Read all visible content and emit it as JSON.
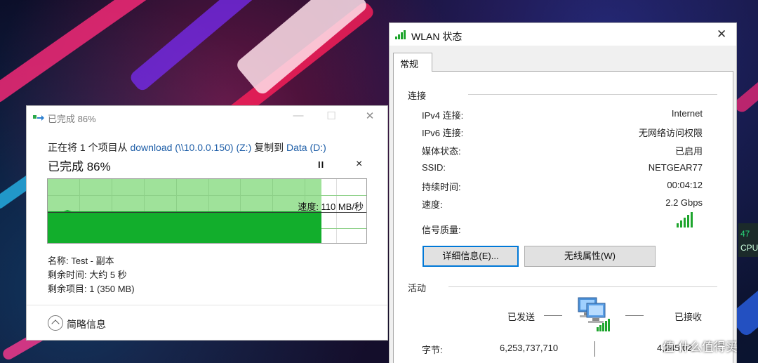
{
  "copy_dialog": {
    "title": "已完成 86%",
    "progress_percent": 86,
    "desc": {
      "prefix": "正在将 1 个项目从 ",
      "source": "download (\\\\10.0.0.150) (Z:)",
      "middle": " 复制到 ",
      "dest": "Data (D:)"
    },
    "heading": "已完成 86%",
    "pause_label": "II",
    "cancel_label": "×",
    "speed_label": "速度: 110 MB/秒",
    "name_line": "名称: Test - 副本",
    "time_line": "剩余时间: 大约 5 秒",
    "items_line": "剩余项目: 1 (350 MB)",
    "fewer_details": "简略信息",
    "window_controls": {
      "minimize": "—",
      "maximize": "☐",
      "close": "✕"
    }
  },
  "wlan_dialog": {
    "title": "WLAN 状态",
    "close_label": "✕",
    "tab_general": "常规",
    "connection": {
      "header": "连接",
      "rows": [
        {
          "label": "IPv4 连接:",
          "value": "Internet"
        },
        {
          "label": "IPv6 连接:",
          "value": "无网络访问权限"
        },
        {
          "label": "媒体状态:",
          "value": "已启用"
        },
        {
          "label": "SSID:",
          "value": "NETGEAR77"
        },
        {
          "label": "持续时间:",
          "value": "00:04:12"
        },
        {
          "label": "速度:",
          "value": "2.2 Gbps"
        }
      ],
      "signal_label": "信号质量:",
      "signal_bars": 5
    },
    "details_button": "详细信息(E)...",
    "wireless_props_button": "无线属性(W)",
    "activity": {
      "header": "活动",
      "sent_label": "已发送",
      "received_label": "已接收",
      "bytes_label": "字节:",
      "bytes_sent": "6,253,737,710",
      "bytes_received": "4,245,02"
    }
  },
  "side_widget": {
    "percent": "47",
    "label": "CPU"
  },
  "watermark": "值 什么值得买"
}
